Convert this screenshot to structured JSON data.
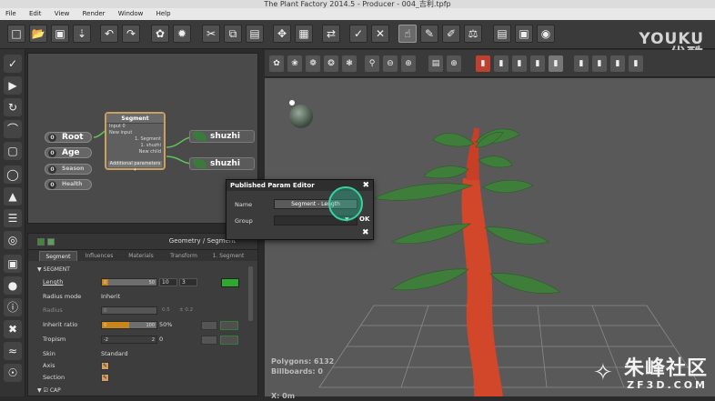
{
  "window": {
    "title": "The Plant Factory 2014.5 - Producer - 004_吉利.tpfp"
  },
  "menu": [
    "File",
    "Edit",
    "View",
    "Render",
    "Window",
    "Help"
  ],
  "graph": {
    "params": [
      {
        "label": "Root",
        "cap": "0"
      },
      {
        "label": "Age",
        "cap": "0"
      },
      {
        "label": "Season",
        "cap": "0"
      },
      {
        "label": "Health",
        "cap": "0"
      }
    ],
    "segment_node": {
      "title": "Segment",
      "rows": [
        "Input 0",
        "New input",
        "1. Segment",
        "1. shuzhi",
        "New child"
      ],
      "footer": "Additional parameters +"
    },
    "outputs": [
      "shuzhi",
      "shuzhi"
    ]
  },
  "panel": {
    "title": "Geometry / Segment",
    "tabs": [
      "Segment",
      "Influences",
      "Materials",
      "Transform",
      "1. Segment"
    ],
    "section_segment": "SEGMENT",
    "section_cap": "CAP",
    "rows": {
      "length": {
        "label": "Length",
        "slider_min": "0",
        "slider_max": "50",
        "value": "10",
        "step": "3",
        "fraction": 0.12
      },
      "radius_mode": {
        "label": "Radius mode",
        "value": "Inherit"
      },
      "radius": {
        "label": "Radius",
        "slider_min": "0",
        "v1": "0.5",
        "v2": "± 0.2"
      },
      "inherit_ratio": {
        "label": "Inherit ratio",
        "slider_min": "0",
        "slider_max": "100",
        "value": "50%",
        "fraction": 0.5
      },
      "tropism": {
        "label": "Tropism",
        "slider_min": "-2",
        "slider_max": "2",
        "value": "0"
      },
      "skin": {
        "label": "Skin",
        "value": "Standard"
      },
      "axis": {
        "label": "Axis"
      },
      "section": {
        "label": "Section"
      }
    }
  },
  "dialog": {
    "title": "Published Param Editor",
    "name_label": "Name",
    "name_value": "Segment - Length",
    "group_label": "Group",
    "ok": "OK"
  },
  "viewport": {
    "stats_polygons": "Polygons: 6132",
    "stats_billboards": "Billboards: 0",
    "stats_x": "X: 0m"
  },
  "watermarks": {
    "youku": "YOUKU",
    "youku_cn": "优酷",
    "zf_cn": "朱峰社区",
    "zf_en": "ZF3D.COM"
  },
  "colors": {
    "accent_orange": "#c8861a",
    "trunk": "#d2462a",
    "leaf": "#3f7d3a",
    "swatch": "#2fa82f",
    "cursor": "#35d4a0"
  }
}
